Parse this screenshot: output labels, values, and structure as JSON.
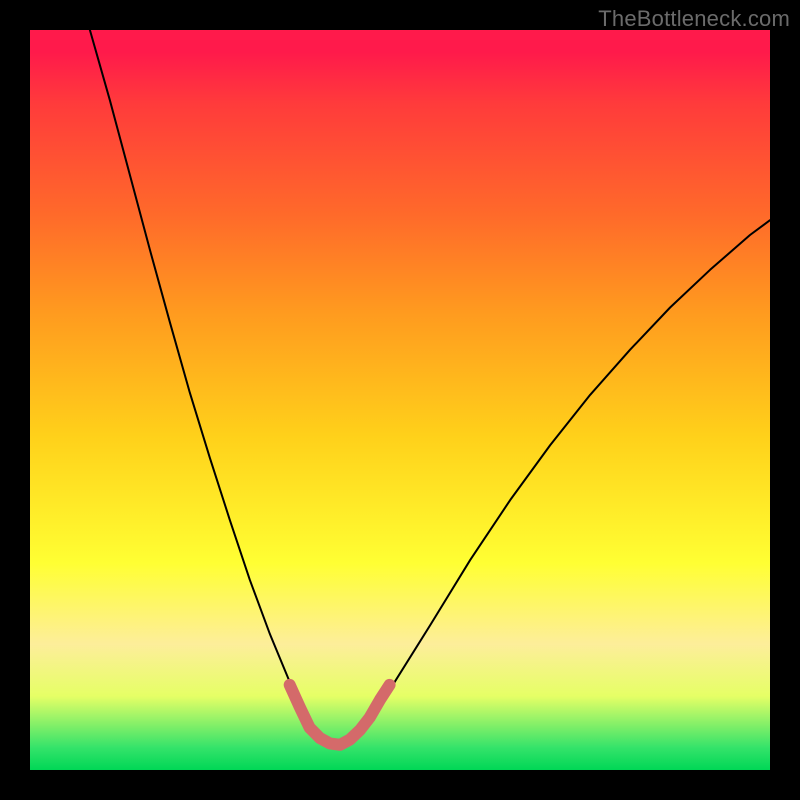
{
  "watermark": "TheBottleneck.com",
  "chart_data": {
    "type": "line",
    "title": "",
    "xlabel": "",
    "ylabel": "",
    "xlim": [
      0,
      100
    ],
    "ylim": [
      0,
      100
    ],
    "note": "No numeric axes; values are relative % of plot area. Two thin black V-shaped curves descend to a trough near x≈40 and rise again; a thick pink segment highlights the trough.",
    "series": [
      {
        "name": "left-curve",
        "stroke": "#000000",
        "stroke_width": 2,
        "points_relative": [
          {
            "x": 8.1,
            "y": 100.0
          },
          {
            "x": 10.8,
            "y": 90.5
          },
          {
            "x": 13.5,
            "y": 80.4
          },
          {
            "x": 16.2,
            "y": 70.3
          },
          {
            "x": 18.9,
            "y": 60.5
          },
          {
            "x": 21.6,
            "y": 51.0
          },
          {
            "x": 24.3,
            "y": 42.2
          },
          {
            "x": 27.0,
            "y": 33.8
          },
          {
            "x": 29.7,
            "y": 25.7
          },
          {
            "x": 32.4,
            "y": 18.4
          },
          {
            "x": 35.1,
            "y": 11.9
          },
          {
            "x": 37.8,
            "y": 6.6
          }
        ]
      },
      {
        "name": "right-curve",
        "stroke": "#000000",
        "stroke_width": 2,
        "points_relative": [
          {
            "x": 45.9,
            "y": 6.6
          },
          {
            "x": 48.6,
            "y": 10.8
          },
          {
            "x": 54.1,
            "y": 19.6
          },
          {
            "x": 59.5,
            "y": 28.4
          },
          {
            "x": 64.9,
            "y": 36.5
          },
          {
            "x": 70.3,
            "y": 43.9
          },
          {
            "x": 75.7,
            "y": 50.7
          },
          {
            "x": 81.1,
            "y": 56.8
          },
          {
            "x": 86.5,
            "y": 62.5
          },
          {
            "x": 91.9,
            "y": 67.6
          },
          {
            "x": 97.3,
            "y": 72.3
          },
          {
            "x": 100.0,
            "y": 74.3
          }
        ]
      },
      {
        "name": "trough-highlight",
        "stroke": "#d46a6a",
        "stroke_width": 12,
        "points_relative": [
          {
            "x": 35.1,
            "y": 11.5
          },
          {
            "x": 36.5,
            "y": 8.4
          },
          {
            "x": 37.8,
            "y": 5.7
          },
          {
            "x": 39.2,
            "y": 4.3
          },
          {
            "x": 40.5,
            "y": 3.6
          },
          {
            "x": 41.9,
            "y": 3.4
          },
          {
            "x": 43.2,
            "y": 4.1
          },
          {
            "x": 44.6,
            "y": 5.4
          },
          {
            "x": 45.9,
            "y": 7.1
          },
          {
            "x": 47.3,
            "y": 9.5
          },
          {
            "x": 48.6,
            "y": 11.5
          }
        ]
      }
    ]
  }
}
